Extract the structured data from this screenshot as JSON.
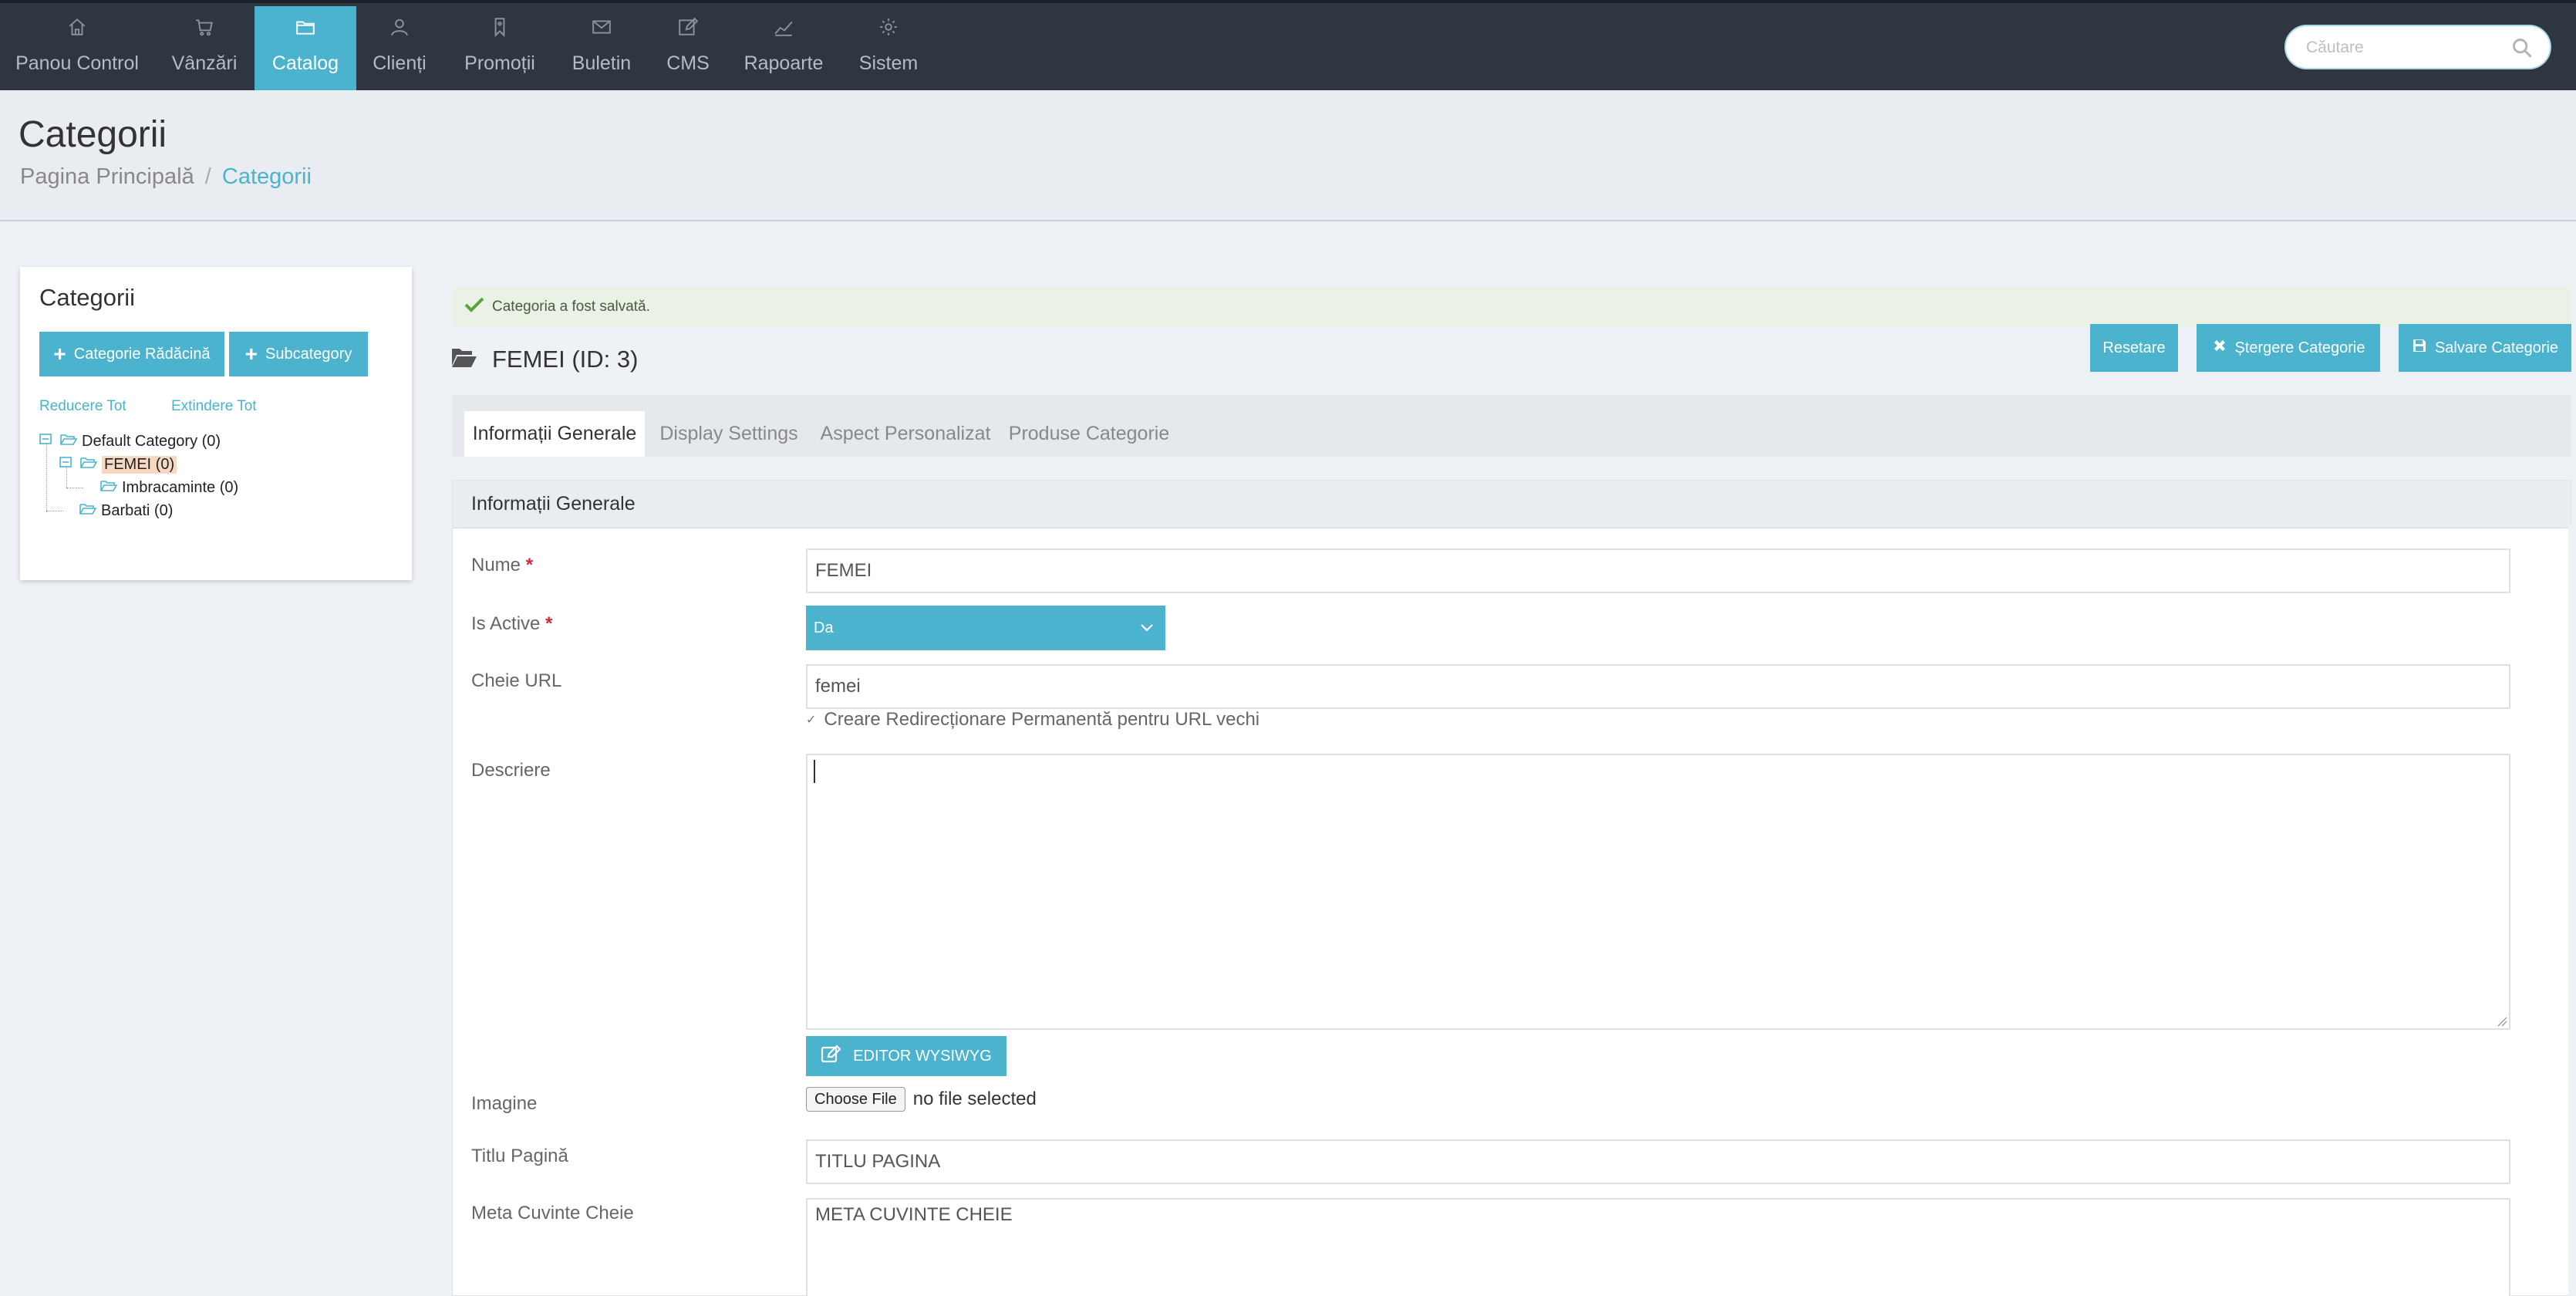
{
  "nav": {
    "items": [
      {
        "label": "Panou Control",
        "icon": "home-icon"
      },
      {
        "label": "Vânzări",
        "icon": "cart-icon"
      },
      {
        "label": "Catalog",
        "icon": "folder-icon",
        "active": true
      },
      {
        "label": "Clienți",
        "icon": "user-icon"
      },
      {
        "label": "Promoții",
        "icon": "tag-icon"
      },
      {
        "label": "Buletin",
        "icon": "mail-icon"
      },
      {
        "label": "CMS",
        "icon": "edit-icon"
      },
      {
        "label": "Rapoarte",
        "icon": "chart-icon"
      },
      {
        "label": "Sistem",
        "icon": "gear-icon"
      }
    ],
    "search_placeholder": "Căutare",
    "accent": "#4bb3cd",
    "bg": "#2f3541"
  },
  "header": {
    "title": "Categorii",
    "breadcrumb": {
      "home": "Pagina Principală",
      "sep": "/",
      "current": "Categorii"
    }
  },
  "sidebar": {
    "title": "Categorii",
    "root_button": "Categorie Rădăcină",
    "sub_button": "Subcategory",
    "collapse_all": "Reducere Tot",
    "expand_all": "Extindere Tot",
    "tree": [
      {
        "label": "Default Category (0)"
      },
      {
        "label": "FEMEI (0)",
        "selected": true
      },
      {
        "label": "Imbracaminte (0)"
      },
      {
        "label": "Barbati (0)"
      }
    ]
  },
  "main": {
    "alert": "Categoria a fost salvată.",
    "category_heading": "FEMEI (ID: 3)",
    "actions": {
      "reset": "Resetare",
      "delete": "Ștergere Categorie",
      "save": "Salvare Categorie"
    },
    "tabs": [
      {
        "label": "Informații Generale",
        "active": true
      },
      {
        "label": "Display Settings"
      },
      {
        "label": "Aspect Personalizat"
      },
      {
        "label": "Produse Categorie"
      }
    ],
    "form": {
      "section_title": "Informații Generale",
      "name_label": "Nume",
      "name_value": "FEMEI",
      "active_label": "Is Active",
      "active_value": "Da",
      "url_label": "Cheie URL",
      "url_value": "femei",
      "redirect_label": "Creare Redirecționare Permanentă pentru URL vechi",
      "desc_label": "Descriere",
      "desc_value": "",
      "wysiwyg_button": "EDITOR WYSIWYG",
      "image_label": "Imagine",
      "choose_file": "Choose File",
      "no_file": "no file selected",
      "page_title_label": "Titlu Pagină",
      "page_title_value": "TITLU PAGINA",
      "meta_keywords_label": "Meta Cuvinte Cheie",
      "meta_keywords_value": "META CUVINTE CHEIE",
      "required_mark": "*"
    }
  }
}
